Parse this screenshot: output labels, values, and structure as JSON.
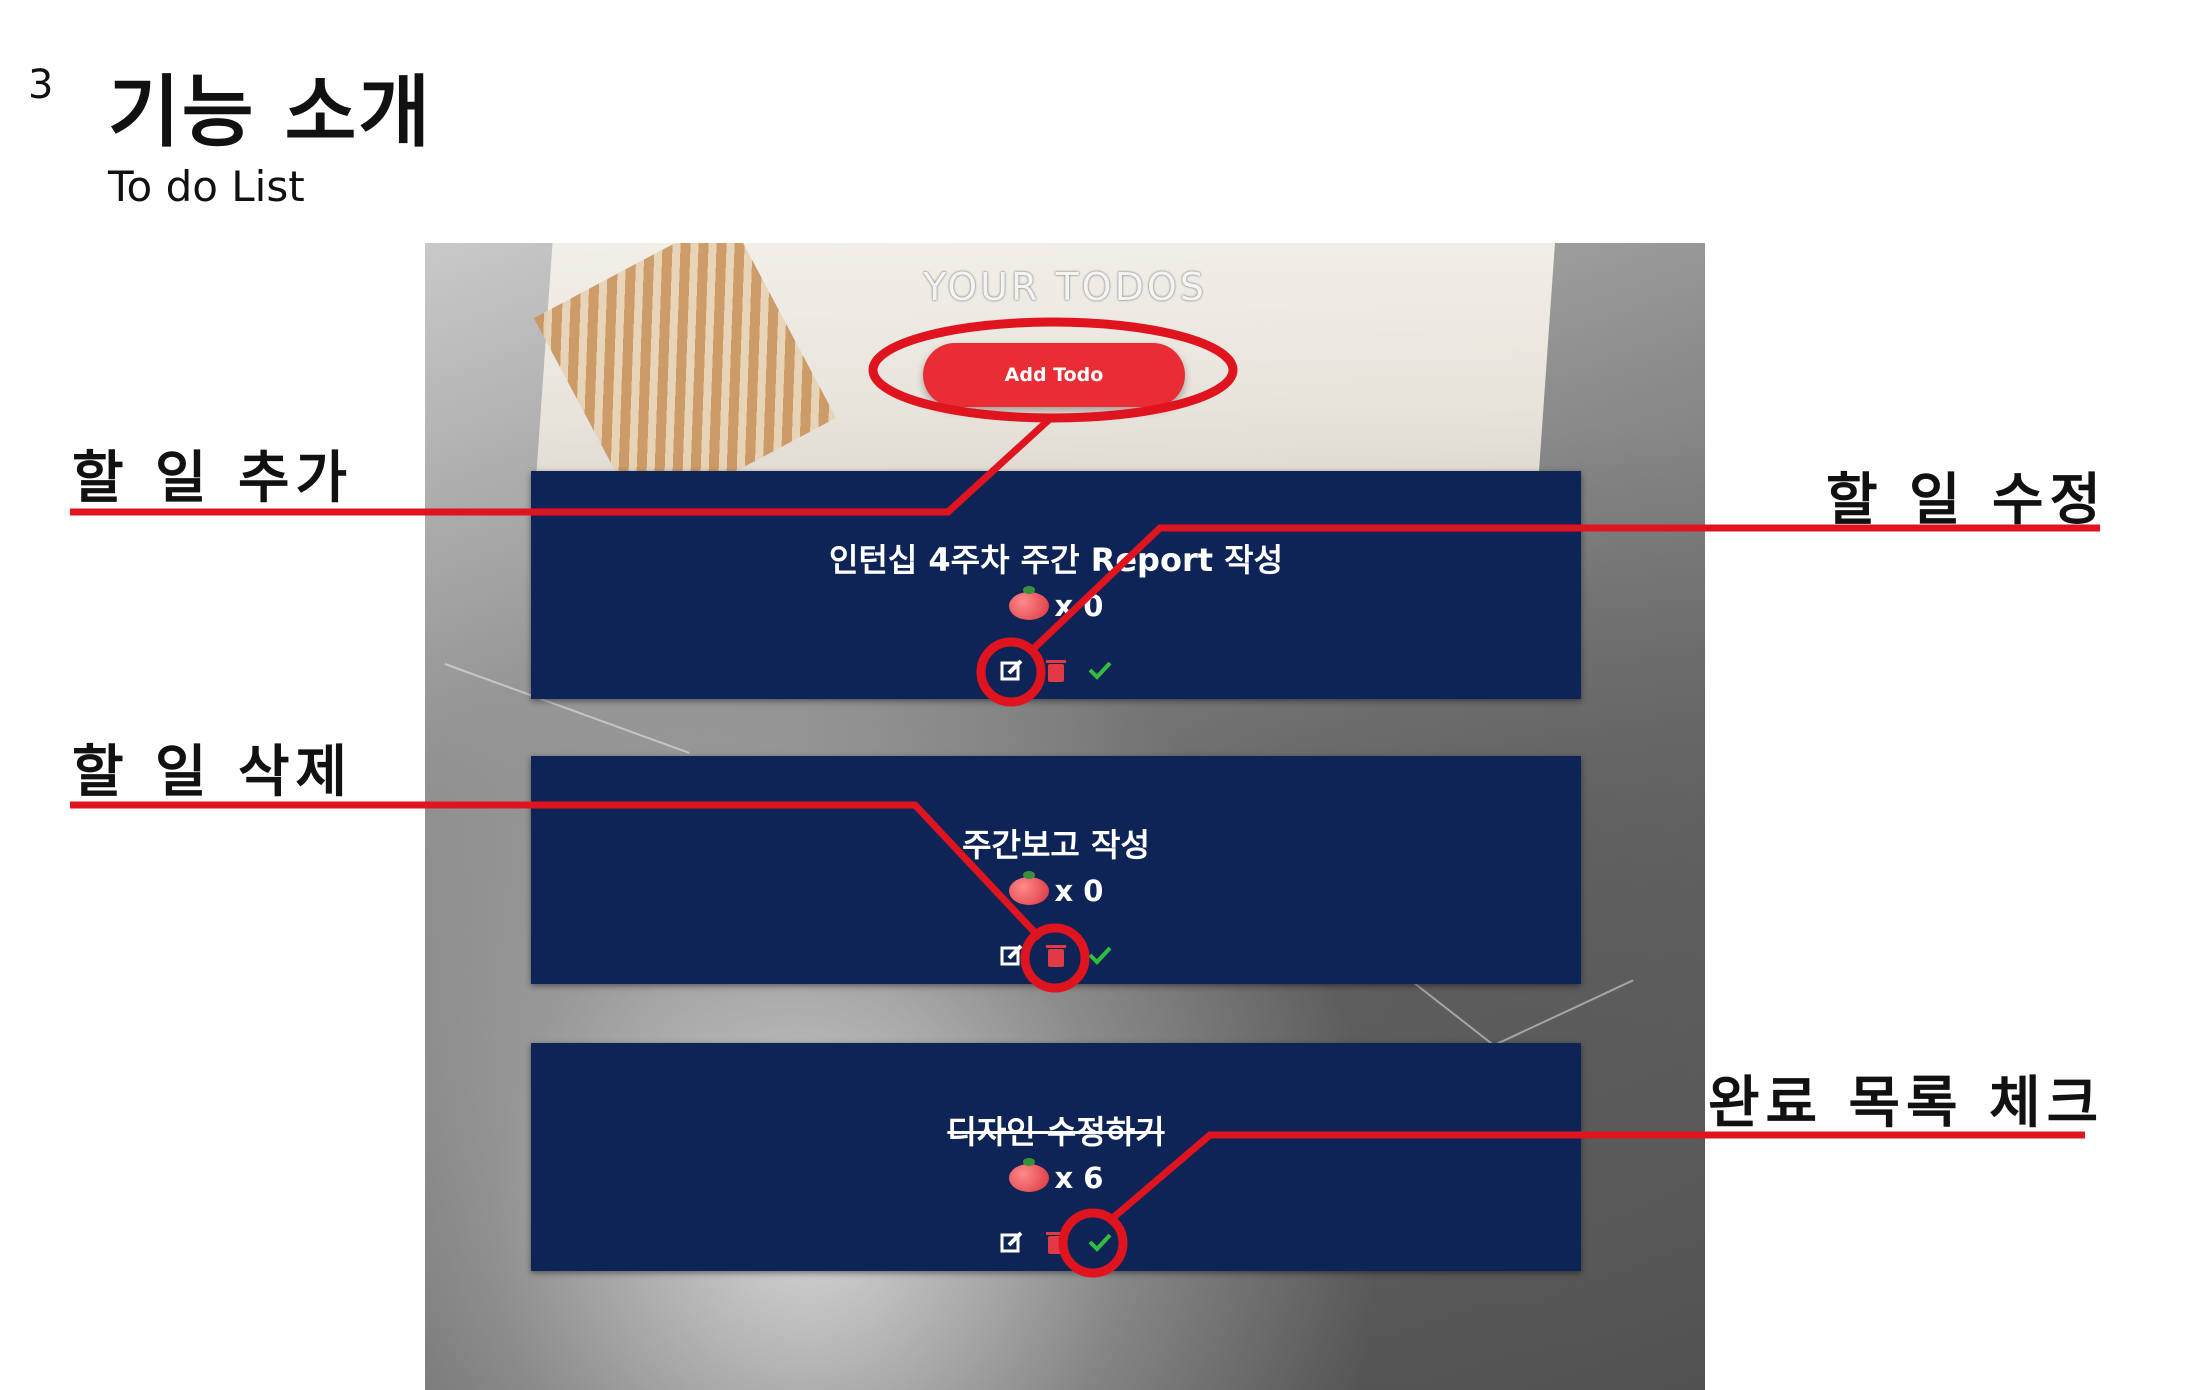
{
  "slide": {
    "number": "3",
    "title": "기능 소개",
    "subtitle": "To do List"
  },
  "app": {
    "heading": "YOUR TODOS",
    "add_button": "Add Todo",
    "todos": [
      {
        "title": "인턴십 4주차 주간 Report 작성",
        "count": "x 0",
        "completed": false
      },
      {
        "title": "주간보고 작성",
        "count": "x 0",
        "completed": false
      },
      {
        "title": "디자인 수정하기",
        "count": "x 6",
        "completed": true
      }
    ],
    "icons": [
      "edit-icon",
      "trash-icon",
      "check-icon",
      "tomato-icon"
    ]
  },
  "callouts": {
    "add": "할 일 추가",
    "edit": "할 일 수정",
    "delete": "할 일 삭제",
    "complete": "완료 목록 체크"
  },
  "colors": {
    "annotation_red": "#e0141e",
    "card_navy": "#0e2456",
    "button_red": "#ea2c34",
    "check_green": "#2fbf3c",
    "trash_red": "#e03a44"
  }
}
